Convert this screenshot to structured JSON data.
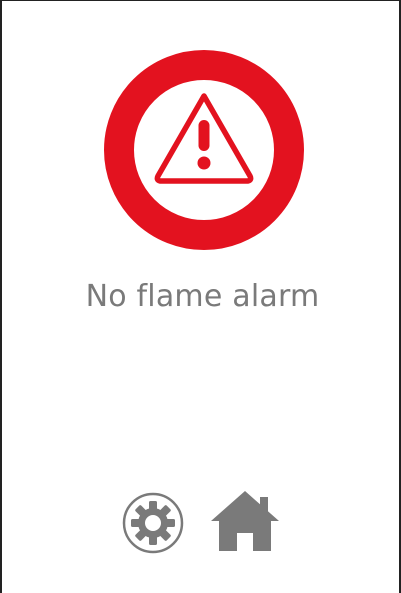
{
  "alarm": {
    "message": "No flame alarm",
    "icon": "warning-icon",
    "accent_color": "#e3121f"
  },
  "navigation": {
    "settings_icon": "gear-icon",
    "home_icon": "home-icon",
    "icon_color": "#7a7a7a"
  }
}
